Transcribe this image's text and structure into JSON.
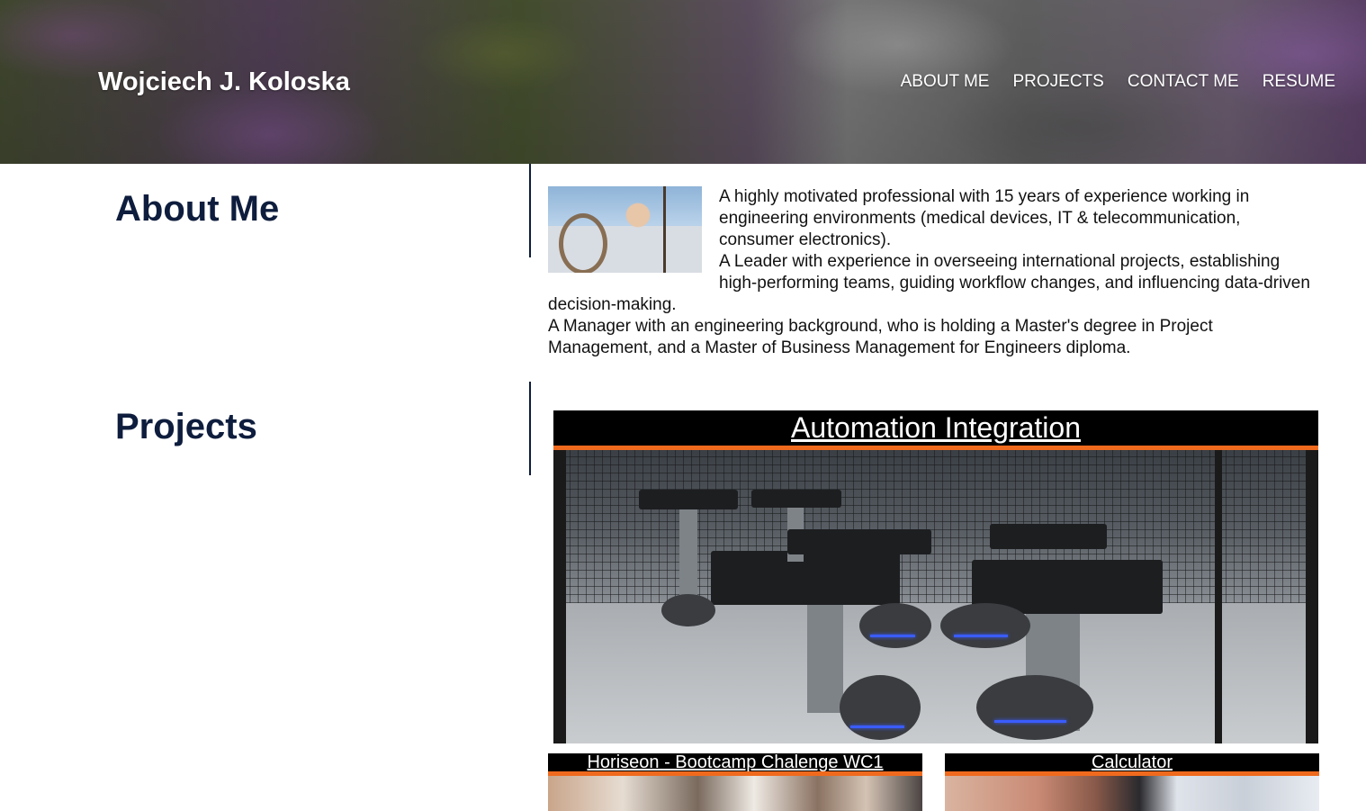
{
  "header": {
    "site_title": "Wojciech J. Koloska",
    "nav": [
      "ABOUT ME",
      "PROJECTS",
      "CONTACT ME",
      "RESUME"
    ]
  },
  "about": {
    "heading": "About Me",
    "paragraphs": [
      "A highly motivated professional with 15 years of experience working in engineering environments (medical devices, IT & telecommunication, consumer electronics).",
      "A Leader with experience in overseeing international projects, establishing high-performing teams, guiding workflow changes, and influencing data-driven decision-making.",
      "A Manager with an engineering background, who is holding a Master's degree in Project Management, and a Master of Business Management for Engineers diploma."
    ]
  },
  "projects": {
    "heading": "Projects",
    "featured": {
      "title": "Automation Integration"
    },
    "items": [
      {
        "title": "Horiseon - Bootcamp Chalenge WC1"
      },
      {
        "title": "Calculator"
      }
    ]
  },
  "colors": {
    "heading": "#0e1d3d",
    "title_bar": "#000000",
    "accent": "#f06a1d"
  }
}
